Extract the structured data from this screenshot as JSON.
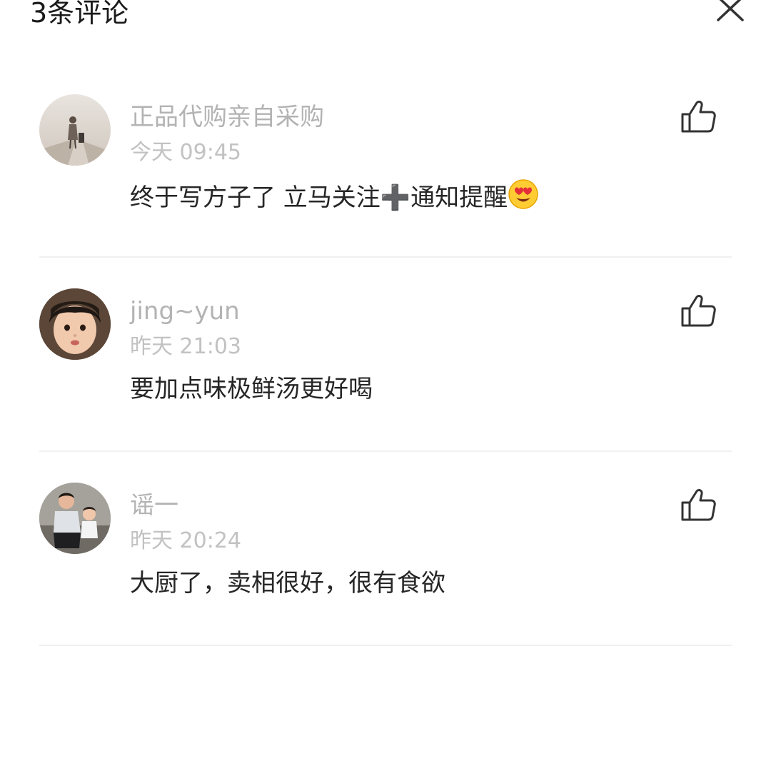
{
  "header": {
    "title": "3条评论",
    "close_icon": "close-icon"
  },
  "comments": [
    {
      "username": "正品代购亲自采购",
      "time": "今天 09:45",
      "text_before": "终于写方子了 立马关注",
      "plus_symbol": "➕",
      "text_after": "通知提醒",
      "emoji": "heart-eyes-emoji",
      "like_icon": "thumbs-up-icon"
    },
    {
      "username": "jing~yun",
      "time": "昨天 21:03",
      "text": "要加点味极鲜汤更好喝",
      "like_icon": "thumbs-up-icon"
    },
    {
      "username": "谣一",
      "time": "昨天 20:24",
      "text": "大厨了，卖相很好，很有食欲",
      "like_icon": "thumbs-up-icon"
    }
  ],
  "colors": {
    "username": "#b3b3b3",
    "time": "#c2c2c2",
    "text": "#262626",
    "divider": "#f0f0f0"
  }
}
